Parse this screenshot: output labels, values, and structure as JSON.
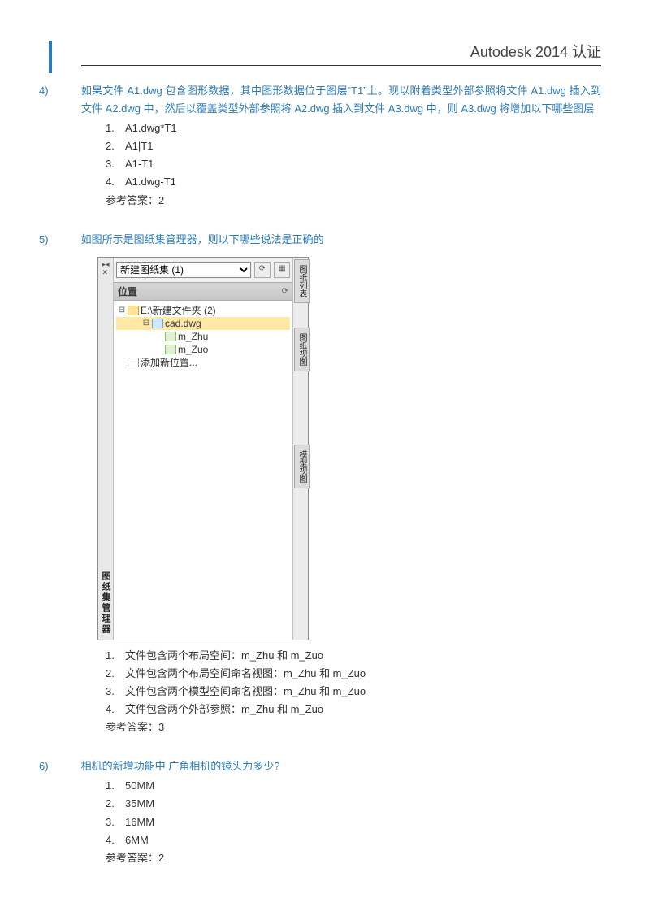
{
  "header": {
    "title": "Autodesk 2014 认证"
  },
  "q4": {
    "num": "4)",
    "text": "如果文件 A1.dwg 包含图形数据，其中图形数据位于图层“T1”上。现以附着类型外部参照将文件 A1.dwg 插入到文件 A2.dwg 中，然后以覆盖类型外部参照将 A2.dwg 插入到文件 A3.dwg 中，则 A3.dwg 将增加以下哪些图层",
    "opts": [
      "A1.dwg*T1",
      "A1|T1",
      "A1-T1",
      "A1.dwg-T1"
    ],
    "answer_label": "参考答案：",
    "answer": "2"
  },
  "q5": {
    "num": "5)",
    "text": "如图所示是图纸集管理器，则以下哪些说法是正确的",
    "panel": {
      "left_label": "图纸集管理器",
      "dropdown": "新建图纸集 (1)",
      "section": "位置",
      "tree": {
        "root": "E:\\新建文件夹 (2)",
        "file": "cad.dwg",
        "view1": "m_Zhu",
        "view2": "m_Zuo",
        "add": "添加新位置..."
      },
      "tabs": [
        "图纸列表",
        "图纸视图",
        "模型视图"
      ]
    },
    "opts": [
      "文件包含两个布局空间：m_Zhu 和 m_Zuo",
      "文件包含两个布局空间命名视图：m_Zhu 和 m_Zuo",
      "文件包含两个模型空间命名视图：m_Zhu 和 m_Zuo",
      "文件包含两个外部参照：m_Zhu 和 m_Zuo"
    ],
    "answer_label": "参考答案：",
    "answer": "3"
  },
  "q6": {
    "num": "6)",
    "text": "相机的新增功能中,广角相机的镜头为多少?",
    "opts": [
      "50MM",
      "35MM",
      "16MM",
      "6MM"
    ],
    "answer_label": "参考答案：",
    "answer": "2"
  },
  "optnums": [
    "1.",
    "2.",
    "3.",
    "4."
  ]
}
